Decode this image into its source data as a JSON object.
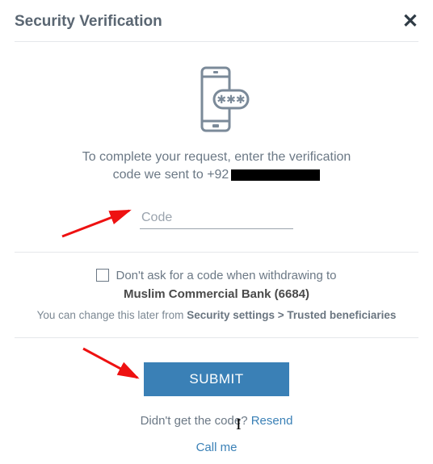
{
  "header": {
    "title": "Security Verification",
    "close_glyph": "✕"
  },
  "instruction": {
    "line1": "To complete your request, enter the verification",
    "line2_prefix": "code we sent to",
    "phone_prefix": "+92"
  },
  "form": {
    "code_placeholder": "Code"
  },
  "checkbox": {
    "label": "Don't ask for a code when withdrawing to",
    "bank": "Muslim Commercial Bank (6684)"
  },
  "settings_note": {
    "prefix": "You can change this later from ",
    "path": "Security settings > Trusted beneficiaries"
  },
  "actions": {
    "submit": "SUBMIT",
    "resend_prompt": "Didn't get the code? ",
    "resend_link": "Resend",
    "call_me": "Call me"
  },
  "icons": {
    "phone_sms": "phone-sms-icon",
    "close": "close-icon"
  }
}
